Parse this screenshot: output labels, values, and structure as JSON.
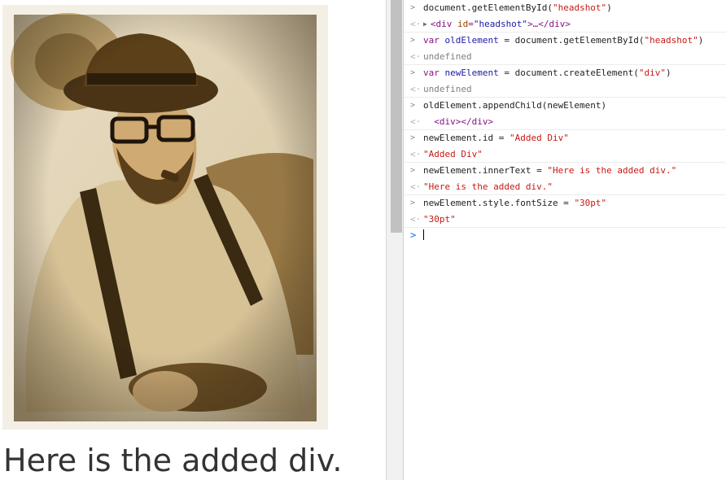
{
  "page": {
    "added_div_text": "Here is the added div.",
    "image_alt": "headshot"
  },
  "console": {
    "lines": [
      {
        "kind": "input",
        "parts": [
          [
            "plain",
            "document.getElementById("
          ],
          [
            "str",
            "\"headshot\""
          ],
          [
            "plain",
            ")"
          ]
        ]
      },
      {
        "kind": "output",
        "parts": [
          [
            "tag",
            "<div "
          ],
          [
            "attr",
            "id"
          ],
          [
            "tag",
            "="
          ],
          [
            "attrv",
            "\"headshot\""
          ],
          [
            "tag",
            ">…</div>"
          ]
        ]
      },
      {
        "kind": "input",
        "parts": [
          [
            "kw",
            "var "
          ],
          [
            "var",
            "oldElement"
          ],
          [
            "plain",
            " = document.getElementById("
          ],
          [
            "str",
            "\"headshot\""
          ],
          [
            "plain",
            ")"
          ]
        ]
      },
      {
        "kind": "output",
        "parts": [
          [
            "undef",
            "undefined"
          ]
        ]
      },
      {
        "kind": "input",
        "parts": [
          [
            "kw",
            "var "
          ],
          [
            "var",
            "newElement"
          ],
          [
            "plain",
            " = document.createElement("
          ],
          [
            "str",
            "\"div\""
          ],
          [
            "plain",
            ")"
          ]
        ]
      },
      {
        "kind": "output",
        "parts": [
          [
            "undef",
            "undefined"
          ]
        ]
      },
      {
        "kind": "input",
        "parts": [
          [
            "plain",
            "oldElement.appendChild(newElement)"
          ]
        ]
      },
      {
        "kind": "output",
        "parts": [
          [
            "tag",
            "  <div></div>"
          ]
        ]
      },
      {
        "kind": "input",
        "parts": [
          [
            "plain",
            "newElement.id = "
          ],
          [
            "str",
            "\"Added Div\""
          ]
        ]
      },
      {
        "kind": "output",
        "parts": [
          [
            "str",
            "\"Added Div\""
          ]
        ]
      },
      {
        "kind": "input",
        "parts": [
          [
            "plain",
            "newElement.innerText = "
          ],
          [
            "str",
            "\"Here is the added div.\""
          ]
        ]
      },
      {
        "kind": "output",
        "parts": [
          [
            "str",
            "\"Here is the added div.\""
          ]
        ]
      },
      {
        "kind": "input",
        "parts": [
          [
            "plain",
            "newElement.style.fontSize = "
          ],
          [
            "str",
            "\"30pt\""
          ]
        ]
      },
      {
        "kind": "output",
        "parts": [
          [
            "str",
            "\"30pt\""
          ]
        ]
      }
    ],
    "input_marker": ">",
    "output_marker": "<·",
    "prompt_marker": ">",
    "triangle": "▶"
  }
}
